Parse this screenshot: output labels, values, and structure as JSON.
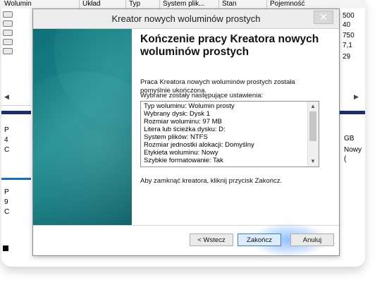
{
  "background_window": {
    "columns": [
      "Wolumin",
      "Układ",
      "Typ",
      "System plik...",
      "Stan",
      "Pojemność"
    ],
    "right_values": [
      "500",
      "40",
      "750",
      "7,1",
      "29"
    ],
    "right_mid": [
      "GB",
      "Nowy ("
    ],
    "left_fragments": [
      "P",
      "4",
      "C",
      "P",
      "9",
      "C"
    ]
  },
  "dialog": {
    "title": "Kreator nowych woluminów prostych",
    "close_label": "✕",
    "heading": "Kończenie pracy Kreatora nowych woluminów prostych",
    "completed_text": "Praca Kreatora nowych woluminów prostych została pomyślnie ukończona.",
    "settings_label": "Wybrane zostały następujące ustawienia:",
    "settings": [
      "Typ woluminu: Wolumin prosty",
      "Wybrany dysk: Dysk 1",
      "Rozmiar woluminu: 97 MB",
      "Litera lub ścieżka dysku: D:",
      "System plików: NTFS",
      "Rozmiar jednostki alokacji: Domyślny",
      "Etykieta woluminu: Nowy",
      "Szybkie formatowanie: Tak"
    ],
    "close_hint": "Aby zamknąć kreatora, kliknij przycisk Zakończ.",
    "buttons": {
      "back": "< Wstecz",
      "finish": "Zakończ",
      "cancel": "Anuluj"
    }
  },
  "colors": {
    "accent_teal": "#0f6f76",
    "focus_glow": "#3c8cff"
  }
}
